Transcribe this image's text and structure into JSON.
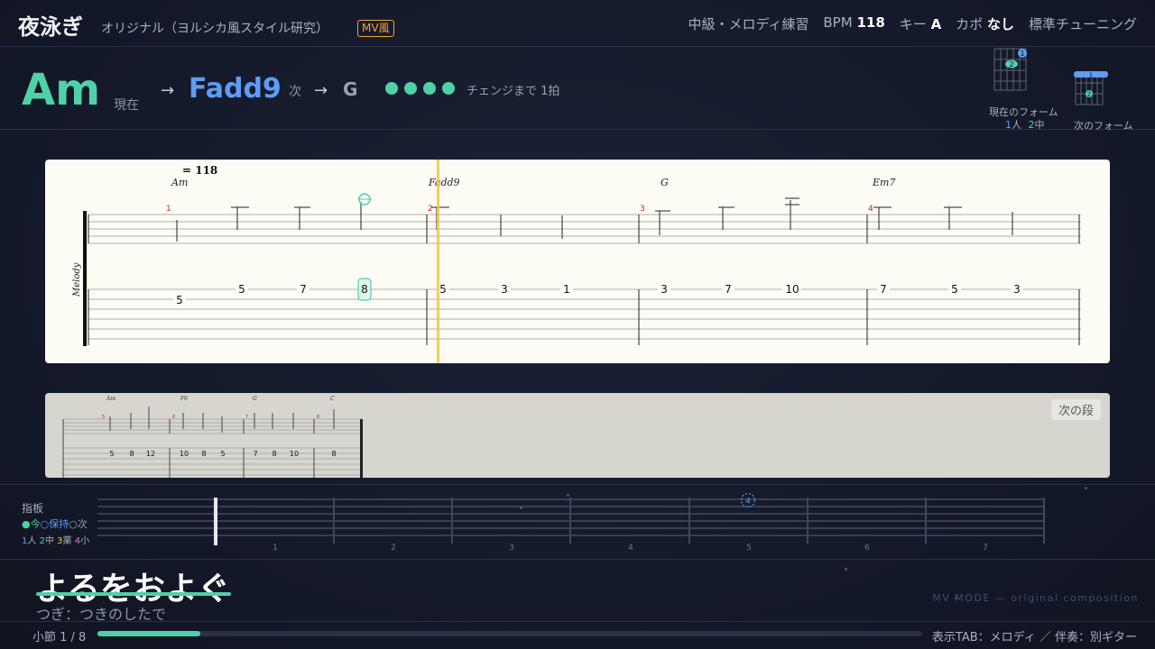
{
  "header": {
    "title": "夜泳ぎ",
    "subtitle": "オリジナル（ヨルシカ風スタイル研究）",
    "badge": "MV風",
    "level": "中級・メロディ練習",
    "bpm_label": "BPM",
    "bpm": "118",
    "key_label": "キー",
    "key": "A",
    "capo_label": "カポ",
    "capo": "なし",
    "tuning": "標準チューニング"
  },
  "chords": {
    "current": "Am",
    "current_label": "現在",
    "arrow": "→",
    "next": "Fadd9",
    "next_label": "次",
    "after": "G",
    "beats_total": 4,
    "beats_lit": 4,
    "countdown": "チェンジまで 1拍"
  },
  "forms": {
    "current_label": "現在のフォーム",
    "fingers": [
      {
        "num": "1",
        "name": "人"
      },
      {
        "num": "2",
        "name": "中"
      }
    ],
    "next_label": "次のフォーム",
    "current_dots": [
      "1",
      "2"
    ],
    "next_dots": [
      "1",
      "2"
    ]
  },
  "score": {
    "tempo": "= 118",
    "track_name": "Melody",
    "measures": [
      {
        "number": "1",
        "chord": "Am",
        "frets": [
          "5",
          "5",
          "7",
          "8"
        ]
      },
      {
        "number": "2",
        "chord": "Fadd9",
        "frets": [
          "5",
          "3",
          "1"
        ]
      },
      {
        "number": "3",
        "chord": "G",
        "frets": [
          "3",
          "7",
          "10"
        ]
      },
      {
        "number": "4",
        "chord": "Em7",
        "frets": [
          "7",
          "5",
          "3"
        ]
      }
    ],
    "highlight_fret": "8"
  },
  "next_row": {
    "button": "次の段",
    "measures": [
      {
        "number": "5",
        "chord": "Am",
        "frets": [
          "5",
          "8",
          "12"
        ]
      },
      {
        "number": "6",
        "chord": "F6",
        "frets": [
          "10",
          "8",
          "5"
        ]
      },
      {
        "number": "7",
        "chord": "G",
        "frets": [
          "7",
          "8",
          "10"
        ]
      },
      {
        "number": "8",
        "chord": "C",
        "frets": [
          "8"
        ]
      }
    ]
  },
  "fretboard": {
    "title": "指板",
    "legend_now": "●今",
    "legend_hold": "○保持",
    "legend_next": "○次",
    "finger_legend": [
      {
        "num": "1",
        "name": "人",
        "color": "#5f9df5"
      },
      {
        "num": "2",
        "name": "中",
        "color": "#4fd1a6"
      },
      {
        "num": "3",
        "name": "薬",
        "color": "#f2c14e"
      },
      {
        "num": "4",
        "name": "小",
        "color": "#d97ae8"
      }
    ],
    "fret_numbers": [
      "1",
      "2",
      "3",
      "4",
      "5",
      "6",
      "7"
    ],
    "next_marker": "4"
  },
  "lyrics": {
    "current": "よるをおよぐ",
    "next": "つぎ：つきのしたで"
  },
  "watermark": "MV MODE — original composition",
  "footer": {
    "measure": "小節 1 / 8",
    "progress": 0.125,
    "display": "表示TAB：メロディ ／ 伴奏：別ギター"
  },
  "colors": {
    "accent_green": "#4fd1a6",
    "accent_blue": "#5f9df5",
    "playhead": "#f5c542",
    "badge_orange": "#f2a33a"
  }
}
